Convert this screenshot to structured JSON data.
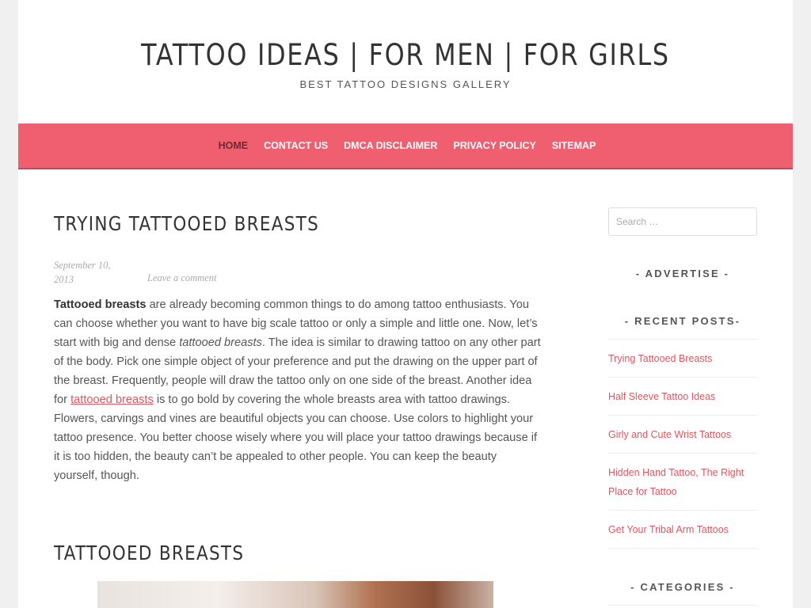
{
  "site": {
    "title": "TATTOO IDEAS | FOR MEN | FOR GIRLS",
    "tagline": "BEST TATTOO DESIGNS GALLERY"
  },
  "nav": {
    "items": [
      {
        "label": "HOME",
        "current": true
      },
      {
        "label": "CONTACT US"
      },
      {
        "label": "DMCA DISCLAIMER"
      },
      {
        "label": "PRIVACY POLICY"
      },
      {
        "label": "SITEMAP"
      }
    ]
  },
  "post": {
    "title": "TRYING TATTOOED BREASTS",
    "date": "September 10, 2013",
    "comment_link": "Leave a comment",
    "body": {
      "bold_lead": "Tattooed breasts",
      "text_1": " are already becoming common things to do among tattoo enthusiasts. You can choose whether you want to have big scale tattoo or only a simple and little one. Now, let’s start with big and dense ",
      "italic": "tattooed breasts",
      "text_2": ". The idea is similar to drawing tattoo on any other part of the body. Pick one simple object of your preference and put the drawing on the upper part of the breast. Frequently, people will draw the tattoo only on one side of the breast. Another idea for ",
      "link": "tattooed breasts",
      "text_3": " is to go bold by covering the whole breasts area with tattoo drawings. Flowers, carvings and vines are beautiful objects you can choose. Use colors to highlight your tattoo presence. You better choose wisely where you will place your tattoo drawings because if it is too hidden, the beauty can’t be appealed to other people. You can keep the beauty yourself, though."
    }
  },
  "section": {
    "title": "TATTOOED BREASTS"
  },
  "sidebar": {
    "search_placeholder": "Search …",
    "advertise_title": "- ADVERTISE -",
    "recent_title": "- RECENT POSTS-",
    "recent_posts": [
      "Trying Tattooed Breasts",
      "Half Sleeve Tattoo Ideas",
      "Girly and Cute Wrist Tattoos",
      "Hidden Hand Tattoo, The Right Place for Tattoo",
      "Get Your Tribal Arm Tattoos"
    ],
    "categories_title": "- CATEGORIES -"
  },
  "colors": {
    "accent": "#ef5f6f",
    "link": "#e0555f",
    "nav_current": "#6d2a32"
  }
}
